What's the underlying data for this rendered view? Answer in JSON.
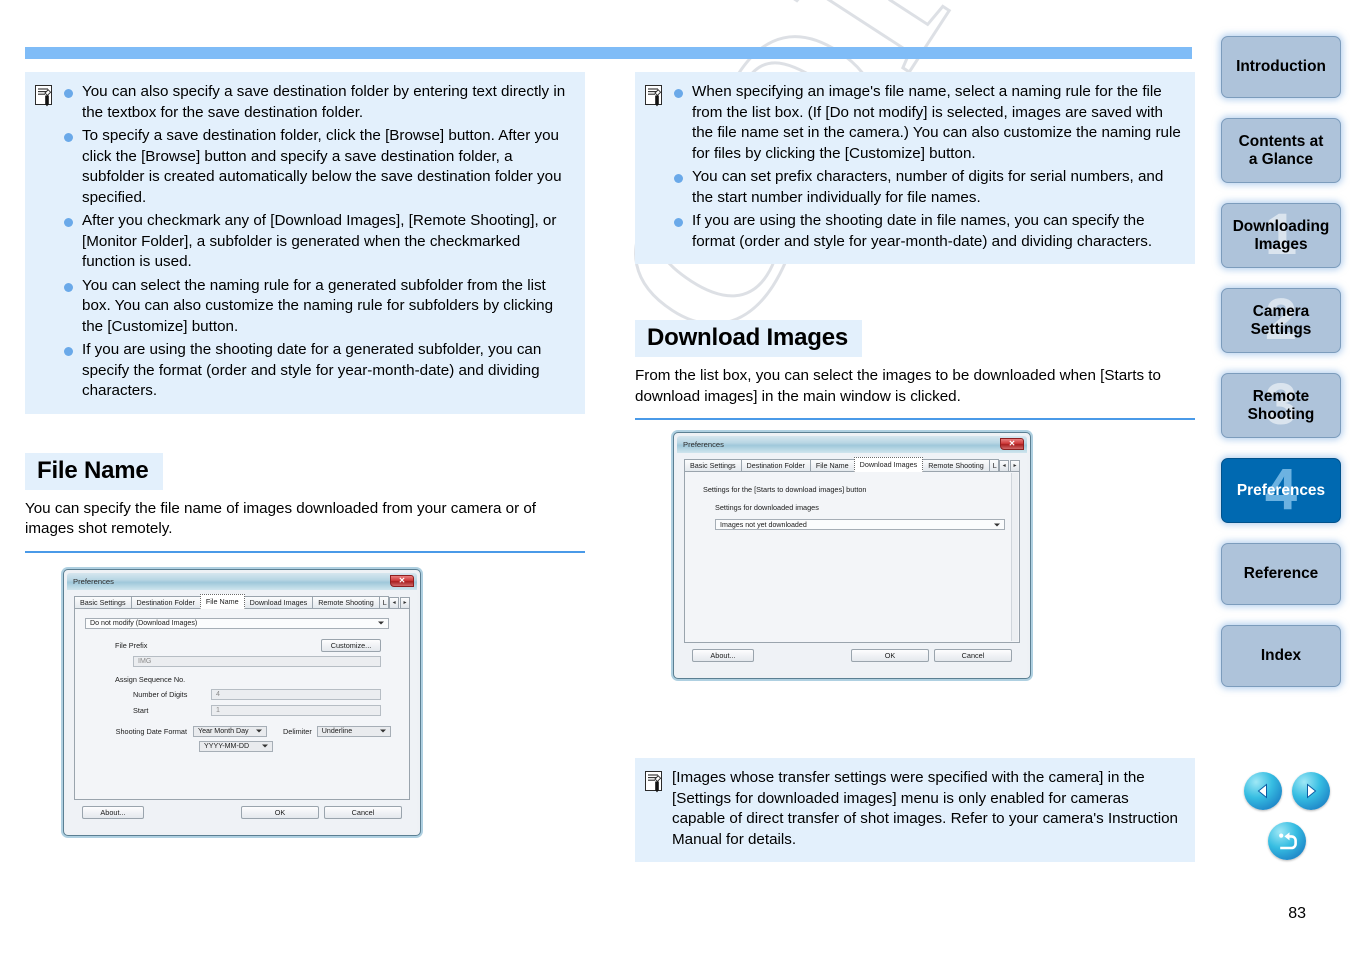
{
  "document": {
    "page_number": "83",
    "watermark": "COPY"
  },
  "left_column": {
    "note_box": {
      "icon": "memo-note-icon",
      "items": [
        "You can also specify a save destination folder by entering text directly in the textbox for the save destination folder.",
        "To specify a save destination folder, click the [Browse] button. After you click the [Browse] button and specify a save destination folder, a subfolder is created automatically below the save destination folder you specified.",
        "After you checkmark any of [Download Images], [Remote Shooting], or [Monitor Folder], a subfolder is generated when the checkmarked function is used.",
        "You can select the naming rule for a generated subfolder from the list box. You can also customize the naming rule for subfolders by clicking the [Customize] button.",
        "If you are using the shooting date for a generated subfolder, you can specify the format (order and style for year-month-date) and dividing characters."
      ]
    },
    "section": {
      "heading": "File Name",
      "body": "You can specify the file name of images downloaded from your camera or of images shot remotely."
    },
    "dialog": {
      "title": "Preferences",
      "close_label": "✕",
      "tabs": [
        "Basic Settings",
        "Destination Folder",
        "File Name",
        "Download Images",
        "Remote Shooting",
        "L"
      ],
      "active_tab": "File Name",
      "spin_prev": "◂",
      "spin_next": "▸",
      "naming_rule_value": "Do not modify (Download Images)",
      "file_prefix_label": "File Prefix",
      "customize_button": "Customize...",
      "file_prefix_value": "IMG",
      "assign_sequence_label": "Assign Sequence No.",
      "digits_label": "Number of Digits",
      "digits_value": "4",
      "start_label": "Start",
      "start_value": "1",
      "shooting_date_label": "Shooting Date Format",
      "shooting_date_value": "Year Month Day",
      "date_style_value": "YYYY-MM-DD",
      "delimiter_label": "Delimiter",
      "delimiter_value": "Underline",
      "about_button": "About...",
      "ok_button": "OK",
      "cancel_button": "Cancel"
    }
  },
  "right_column": {
    "note_box": {
      "icon": "memo-note-icon",
      "items": [
        "When specifying an image's file name, select a naming rule for the file from the list box. (If [Do not modify] is selected, images are saved with the file name set in the camera.) You can also customize the naming rule for files by clicking the [Customize] button.",
        "You can set prefix characters, number of digits for serial numbers, and the start number individually for file names.",
        "If you are using the shooting date in file names, you can specify the format (order and style for year-month-date) and dividing characters."
      ]
    },
    "section": {
      "heading": "Download Images",
      "body": "From the list box, you can select the images to be downloaded when [Starts to download images] in the main window is clicked."
    },
    "dialog": {
      "title": "Preferences",
      "close_label": "✕",
      "tabs": [
        "Basic Settings",
        "Destination Folder",
        "File Name",
        "Download Images",
        "Remote Shooting",
        "L"
      ],
      "active_tab": "Download Images",
      "spin_prev": "◂",
      "spin_next": "▸",
      "settings_heading": "Settings for the [Starts to download images] button",
      "settings_sub_label": "Settings for downloaded images",
      "settings_combo_value": "Images not yet downloaded",
      "about_button": "About...",
      "ok_button": "OK",
      "cancel_button": "Cancel"
    },
    "bottom_note": {
      "icon": "memo-note-icon",
      "text": "[Images whose transfer settings were specified with the camera] in the [Settings for downloaded images] menu is only enabled for cameras capable of direct transfer of shot images. Refer to your camera's Instruction Manual for details."
    }
  },
  "sidebar": {
    "items": [
      {
        "label": "Introduction",
        "number": "",
        "active": false
      },
      {
        "label": "Contents at\na Glance",
        "number": "",
        "active": false
      },
      {
        "label": "Downloading\nImages",
        "number": "1",
        "active": false
      },
      {
        "label": "Camera\nSettings",
        "number": "2",
        "active": false
      },
      {
        "label": "Remote\nShooting",
        "number": "3",
        "active": false
      },
      {
        "label": "Preferences",
        "number": "4",
        "active": true
      },
      {
        "label": "Reference",
        "number": "",
        "active": false
      },
      {
        "label": "Index",
        "number": "",
        "active": false
      }
    ],
    "active_color": "#0069b1",
    "inactive_color": "#aec3da"
  },
  "nav_buttons": {
    "previous": "previous-page-arrow-icon",
    "next": "next-page-arrow-icon",
    "back": "return-back-arrow-icon"
  }
}
